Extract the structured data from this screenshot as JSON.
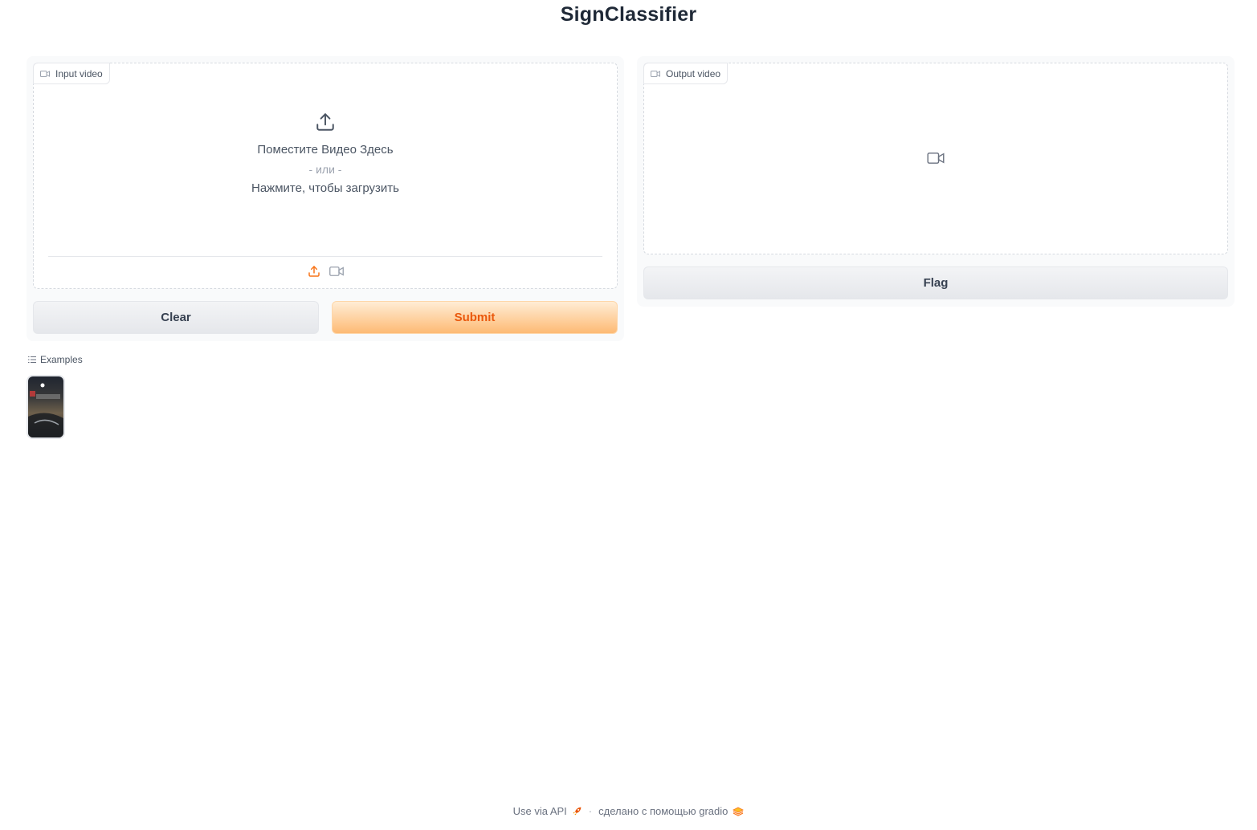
{
  "app": {
    "title": "SignClassifier"
  },
  "input_video": {
    "label": "Input video",
    "drop_text": "Поместите Видео Здесь",
    "or_text": "- или -",
    "click_text": "Нажмите, чтобы загрузить"
  },
  "output_video": {
    "label": "Output video"
  },
  "buttons": {
    "clear": "Clear",
    "submit": "Submit",
    "flag": "Flag"
  },
  "examples": {
    "label": "Examples"
  },
  "footer": {
    "api_text": "Use via API",
    "separator": "·",
    "built_with": "сделано с помощью gradio"
  },
  "colors": {
    "accent": "#f97316",
    "primary_text": "#ea580c"
  }
}
